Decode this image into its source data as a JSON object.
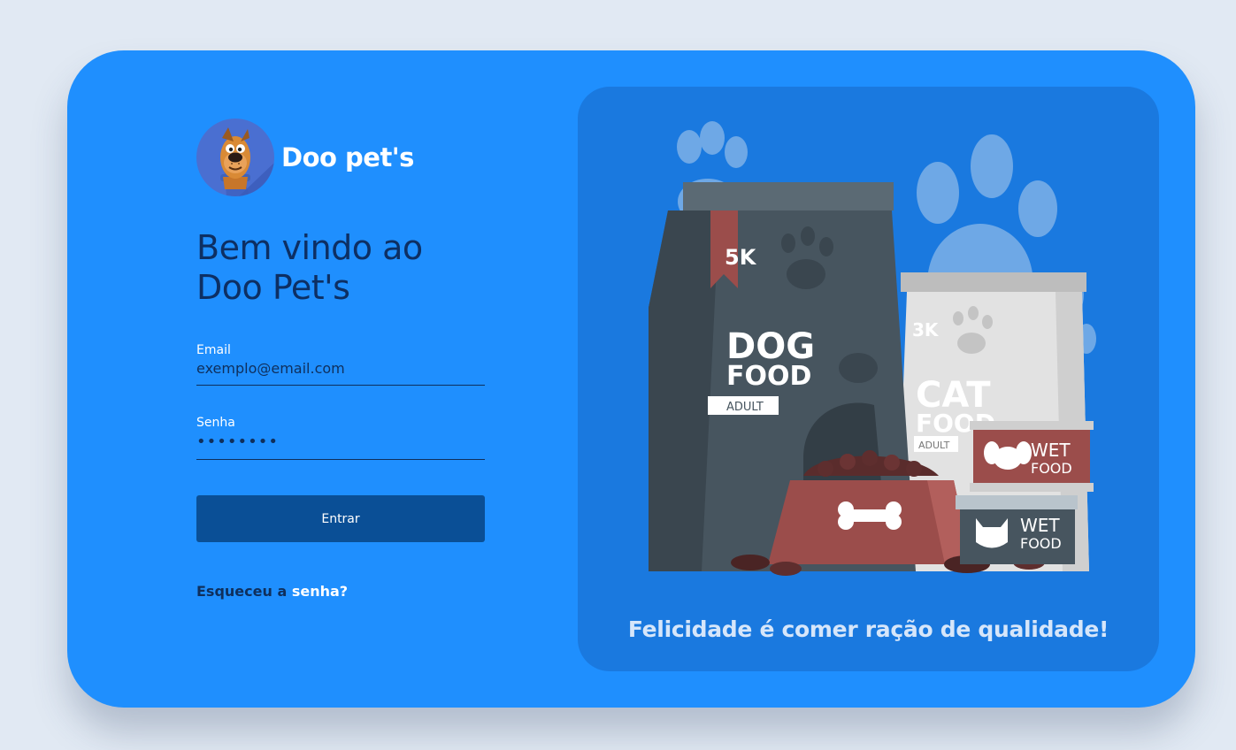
{
  "brand": {
    "name": "Doo pet's",
    "logo_icon": "dog-mascot-icon"
  },
  "welcome": {
    "line1": "Bem vindo ao",
    "line2": "Doo Pet's"
  },
  "form": {
    "email_label": "Email",
    "email_placeholder": "exemplo@email.com",
    "password_label": "Senha",
    "password_value": "••••••••",
    "submit_label": "Entrar"
  },
  "forgot": {
    "prefix": "Esqueceu a ",
    "link": "senha?"
  },
  "promo": {
    "tagline": "Felicidade é comer ração de qualidade!",
    "dog_bag": {
      "weight": "5K",
      "line1": "DOG",
      "line2": "FOOD",
      "tag": "ADULT"
    },
    "cat_bag": {
      "weight": "3K",
      "line1": "CAT",
      "line2": "FOOD",
      "tag": "ADULT"
    },
    "can_top": {
      "line1": "WET",
      "line2": "FOOD"
    },
    "can_bottom": {
      "line1": "WET",
      "line2": "FOOD"
    }
  },
  "colors": {
    "page_bg": "#e1e9f3",
    "card_bg": "#1f8ffe",
    "promo_bg": "#1a79df",
    "button_bg": "#0a4f96",
    "heading": "#0d2f63"
  }
}
